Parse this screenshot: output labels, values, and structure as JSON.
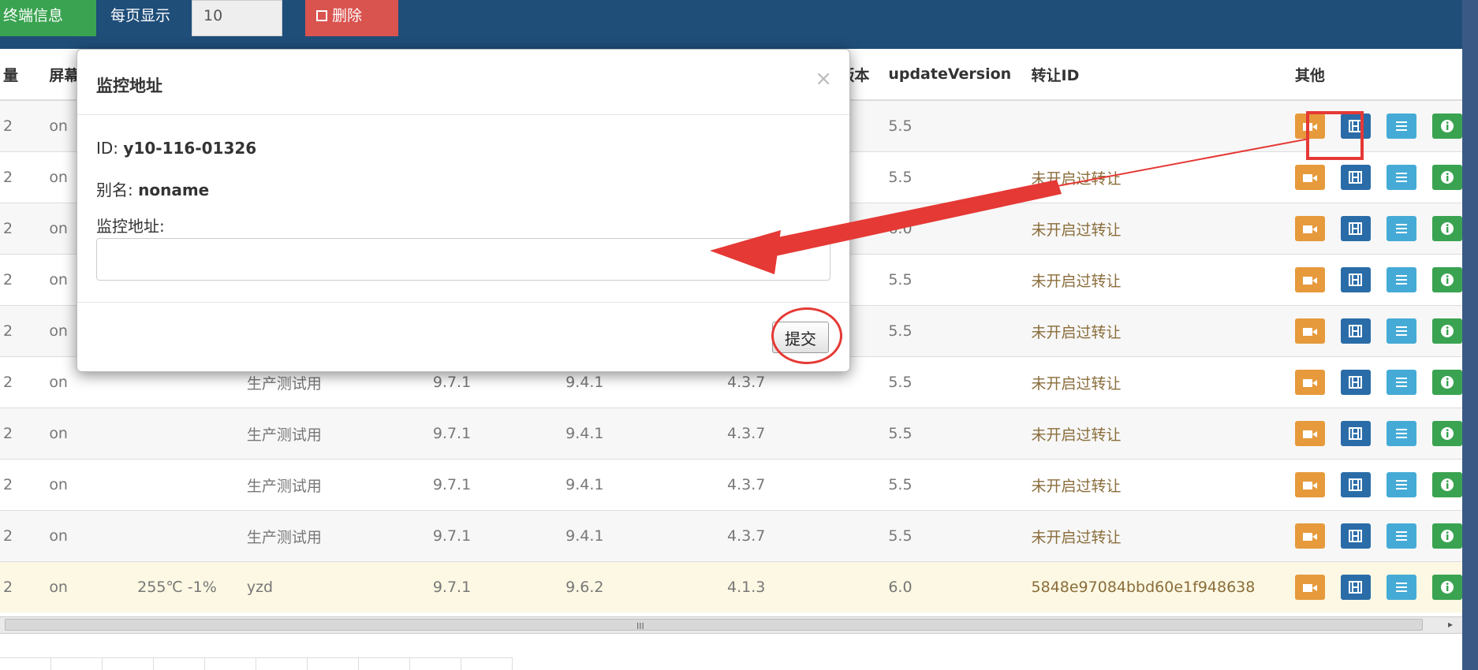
{
  "toolbar": {
    "terminal_info": "终端信息",
    "per_page_label": "每页显示",
    "per_page_value": "10",
    "delete_label": "删除"
  },
  "table": {
    "headers": [
      "量",
      "屏幕",
      "",
      "",
      "",
      "",
      "版本",
      "updateVersion",
      "转让ID",
      "其他"
    ],
    "rows": [
      [
        "2",
        "on",
        "",
        "",
        "",
        "",
        "",
        "5.5",
        ""
      ],
      [
        "2",
        "on",
        "",
        "",
        "",
        "",
        "",
        "5.5",
        "未开启过转让"
      ],
      [
        "2",
        "on",
        "",
        "",
        "",
        "",
        "",
        "6.0",
        "未开启过转让"
      ],
      [
        "2",
        "on",
        "",
        "",
        "",
        "",
        "",
        "5.5",
        "未开启过转让"
      ],
      [
        "2",
        "on",
        "",
        "",
        "",
        "",
        "",
        "5.5",
        "未开启过转让"
      ],
      [
        "2",
        "on",
        "",
        "生产测试用",
        "9.7.1",
        "9.4.1",
        "4.3.7",
        "5.5",
        "未开启过转让"
      ],
      [
        "2",
        "on",
        "",
        "生产测试用",
        "9.7.1",
        "9.4.1",
        "4.3.7",
        "5.5",
        "未开启过转让"
      ],
      [
        "2",
        "on",
        "",
        "生产测试用",
        "9.7.1",
        "9.4.1",
        "4.3.7",
        "5.5",
        "未开启过转让"
      ],
      [
        "2",
        "on",
        "",
        "生产测试用",
        "9.7.1",
        "9.4.1",
        "4.3.7",
        "5.5",
        "未开启过转让"
      ],
      [
        "2",
        "on",
        "255℃ -1%",
        "yzd",
        "9.7.1",
        "9.6.2",
        "4.1.3",
        "6.0",
        "5848e97084bbd60e1f948638"
      ]
    ],
    "action_icons": [
      "video-camera-icon",
      "film-icon",
      "list-icon",
      "info-icon"
    ]
  },
  "modal": {
    "title": "监控地址",
    "close": "×",
    "id_label": "ID: ",
    "id_value": "y10-116-01326",
    "alias_label": "别名: ",
    "alias_value": "noname",
    "address_label": "监控地址:",
    "address_value": "",
    "submit_label": "提交"
  },
  "scrollbar": {
    "grip": "III",
    "arrow": "▸"
  },
  "colors": {
    "topbar": "#1f4e79",
    "success": "#3aa351",
    "danger": "#d9534f",
    "warning": "#e69a3c",
    "primary": "#2a6ca8",
    "info": "#45abd6",
    "annotation": "#e53935"
  }
}
